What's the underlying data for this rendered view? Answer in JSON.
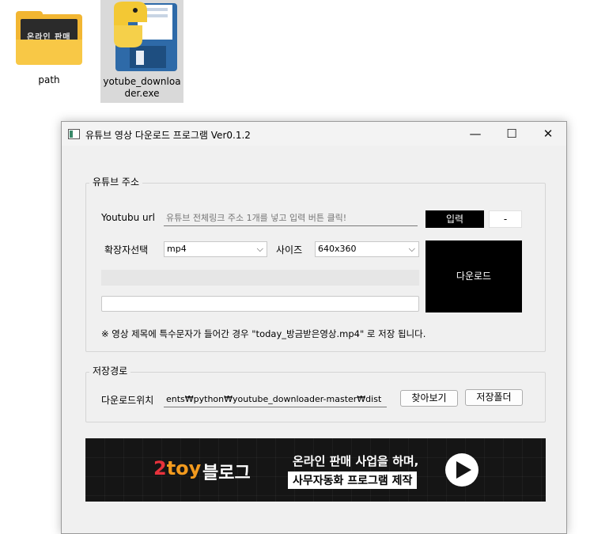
{
  "desktop": {
    "folder": {
      "label": "path",
      "thumbnail_text": "온라인 판매"
    },
    "exe": {
      "label_line1": "yotube_downloa",
      "label_line2": "der.exe"
    }
  },
  "window": {
    "title": "유튜브 영상 다운로드 프로그램 Ver0.1.2",
    "controls": {
      "minimize": "—",
      "maximize": "☐",
      "close": "✕"
    }
  },
  "url_group": {
    "legend": "유튜브 주소",
    "url_label": "Youtubu url",
    "url_placeholder": "유튜브 전체링크 주소 1개를 넣고 입력 버튼 클릭!",
    "input_button": "입력",
    "dash_button": "-",
    "ext_label": "확장자선택",
    "ext_value": "mp4",
    "size_label": "사이즈",
    "size_value": "640x360",
    "download_button": "다운로드",
    "notice": "※ 영상 제목에 특수문자가 들어간 경우 \"today_방금받은영상.mp4\" 로 저장 됩니다."
  },
  "path_group": {
    "legend": "저장경로",
    "location_label": "다운로드위치",
    "location_value": "ents₩python₩youtube_downloader-master₩dist",
    "browse_button": "찾아보기",
    "open_folder_button": "저장폴더"
  },
  "banner": {
    "brand_num": "2",
    "brand_word": "toy",
    "brand_suffix": "블로그",
    "line1": "온라인 판매 사업을 하며,",
    "line2": "사무자동화 프로그램 제작"
  },
  "colors": {
    "folder": "#f2b632",
    "banner_bg": "#151515",
    "brand_red": "#e8323c",
    "brand_orange": "#f39a1e",
    "window_bg": "#f0f0f0"
  }
}
